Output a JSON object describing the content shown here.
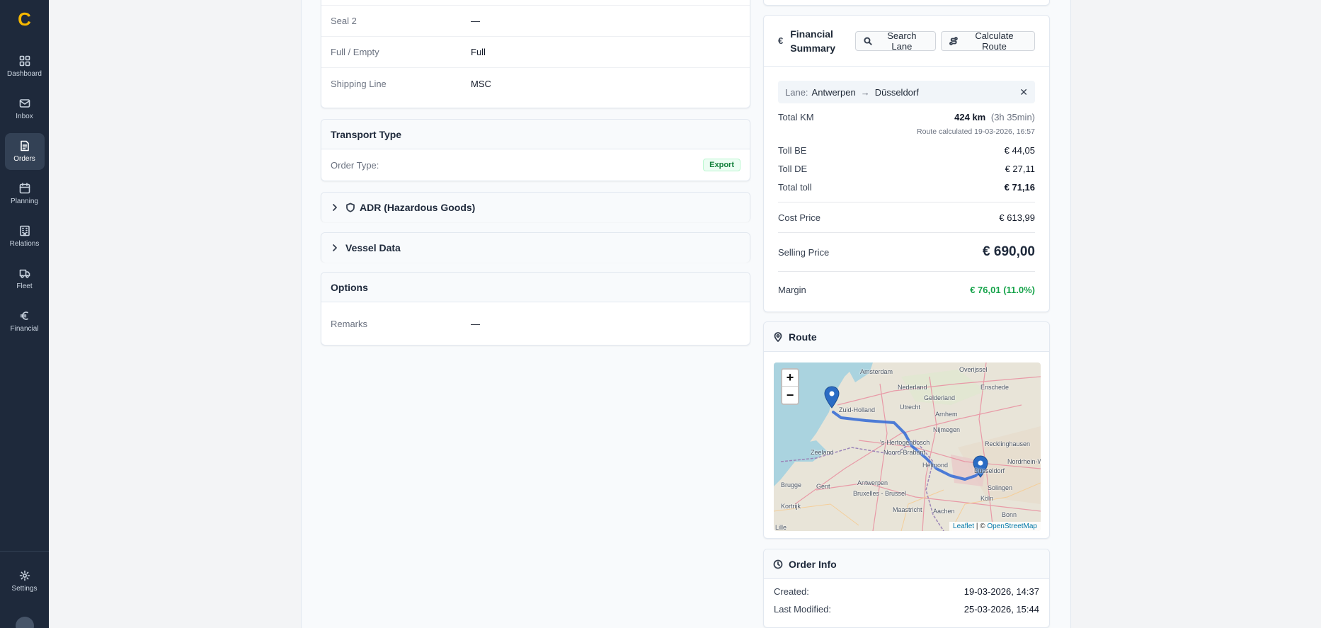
{
  "app": {
    "logo": "C"
  },
  "sidebar": {
    "items": [
      {
        "label": "Dashboard",
        "icon": "grid-icon"
      },
      {
        "label": "Inbox",
        "icon": "mail-icon"
      },
      {
        "label": "Orders",
        "icon": "file-icon"
      },
      {
        "label": "Planning",
        "icon": "calendar-icon"
      },
      {
        "label": "Relations",
        "icon": "building-icon"
      },
      {
        "label": "Fleet",
        "icon": "truck-icon"
      },
      {
        "label": "Financial",
        "icon": "euro-icon"
      }
    ],
    "settings": {
      "label": "Settings",
      "icon": "gear-icon"
    },
    "active": "Orders"
  },
  "container": {
    "rows": [
      {
        "key": "Seal 2",
        "value": "—"
      },
      {
        "key": "Full / Empty",
        "value": "Full"
      },
      {
        "key": "Shipping Line",
        "value": "MSC"
      }
    ]
  },
  "transport": {
    "title": "Transport Type",
    "order_type_label": "Order Type:",
    "order_type_value": "Export"
  },
  "adr": {
    "title": "ADR (Hazardous Goods)"
  },
  "vessel": {
    "title": "Vessel Data"
  },
  "options": {
    "title": "Options",
    "remarks_label": "Remarks",
    "remarks_value": "—"
  },
  "financial": {
    "title": "Financial Summary",
    "search_lane": "Search Lane",
    "calculate_route": "Calculate Route",
    "lane_label": "Lane:",
    "lane_from": "Antwerpen",
    "lane_to": "Düsseldorf",
    "total_km_label": "Total KM",
    "total_km_value": "424 km",
    "duration": "(3h 35min)",
    "route_calculated": "Route calculated 19-03-2026, 16:57",
    "toll_be_label": "Toll BE",
    "toll_be_value": "€ 44,05",
    "toll_de_label": "Toll DE",
    "toll_de_value": "€ 27,11",
    "total_toll_label": "Total toll",
    "total_toll_value": "€ 71,16",
    "cost_label": "Cost Price",
    "cost_value": "€ 613,99",
    "selling_label": "Selling Price",
    "selling_value": "€ 690,00",
    "margin_label": "Margin",
    "margin_value": "€ 76,01 (11.0%)",
    "colors": {
      "margin": "#16a34a"
    }
  },
  "route": {
    "title": "Route",
    "map_labels": [
      "Amsterdam",
      "Nederland",
      "Utrecht",
      "Overijssel",
      "Gelderland",
      "Arnhem",
      "Nijmegen",
      "Enschede",
      "'s-Hertogenbosch",
      "Noord-Brabant",
      "Zeeland",
      "Antwerpen",
      "Bruxelles - Brussel",
      "Gent",
      "Brugge",
      "Kortrijk",
      "Maastricht",
      "Aachen",
      "Köln",
      "Bonn",
      "Solingen",
      "Düsseldorf",
      "Recklinghausen",
      "Nordrhein-Westfalen",
      "Helmond",
      "Zuid-Holland",
      "Lille"
    ],
    "zoom_in": "+",
    "zoom_out": "−",
    "attrib_leaflet": "Leaflet",
    "attrib_sep": "| ©",
    "attrib_osm": "OpenStreetMap"
  },
  "order_info": {
    "title": "Order Info",
    "created_label": "Created:",
    "created_value": "19-03-2026, 14:37",
    "modified_label": "Last Modified:",
    "modified_value": "25-03-2026, 15:44"
  }
}
